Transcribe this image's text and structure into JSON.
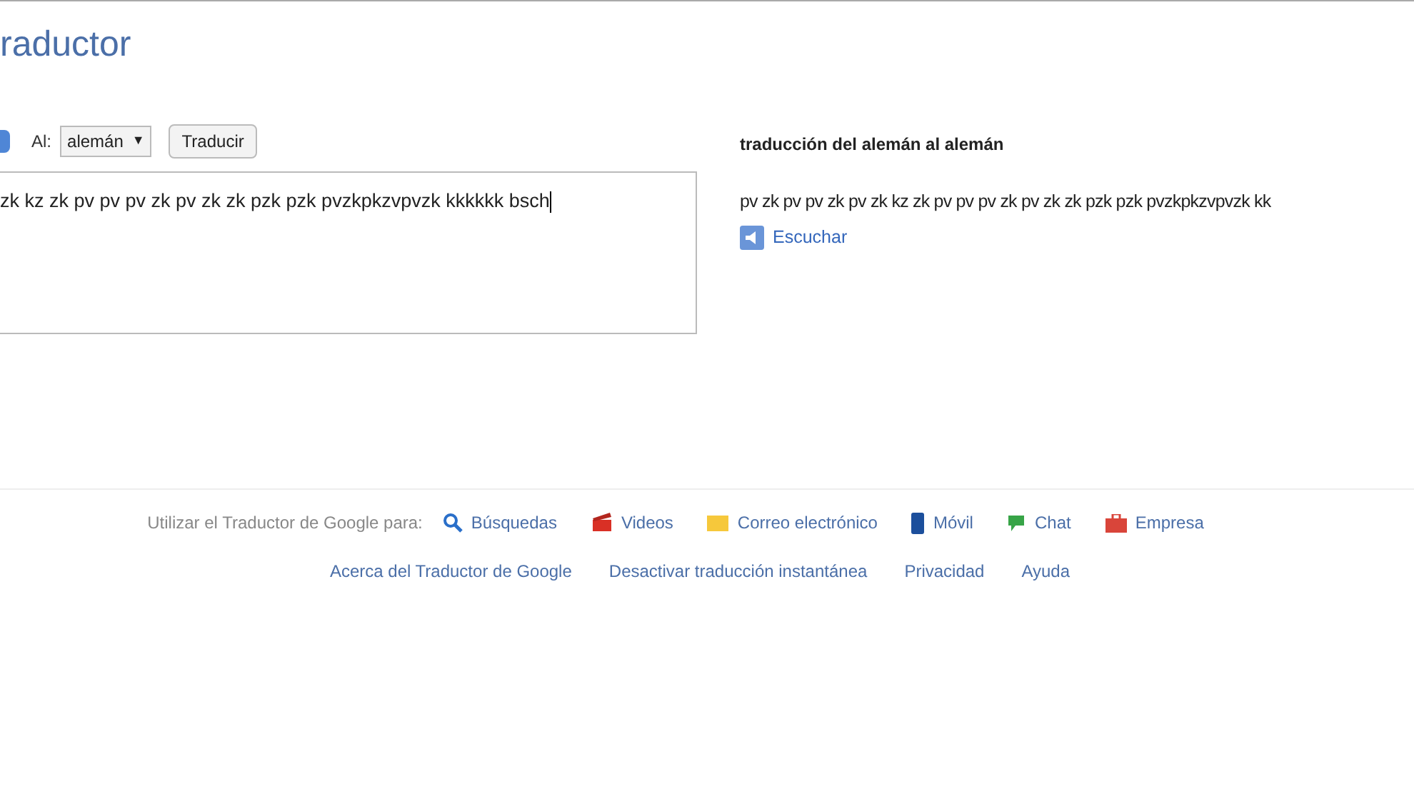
{
  "header": {
    "title": "raductor"
  },
  "controls": {
    "to_label": "Al:",
    "language": "alemán",
    "language_caret": "▼",
    "translate_button": "Traducir"
  },
  "source": {
    "value": "zk kz zk pv pv pv zk pv zk zk pzk pzk pvzkpkzvpvzk kkkkkk bsch"
  },
  "result": {
    "heading": "traducción del alemán al alemán",
    "text": "pv zk pv pv zk pv zk kz zk pv pv pv zk pv zk zk pzk pzk pvzkpkzvpvzk kk",
    "listen": "Escuchar"
  },
  "footer": {
    "use_label": "Utilizar el Traductor de Google para:",
    "products": [
      {
        "kind": "search",
        "label": "Búsquedas"
      },
      {
        "kind": "video",
        "label": "Videos"
      },
      {
        "kind": "mail",
        "label": "Correo electrónico"
      },
      {
        "kind": "mobile",
        "label": "Móvil"
      },
      {
        "kind": "chat",
        "label": "Chat"
      },
      {
        "kind": "business",
        "label": "Empresa"
      }
    ],
    "links": [
      "Acerca del Traductor de Google",
      "Desactivar traducción instantánea",
      "Privacidad",
      "Ayuda"
    ]
  }
}
